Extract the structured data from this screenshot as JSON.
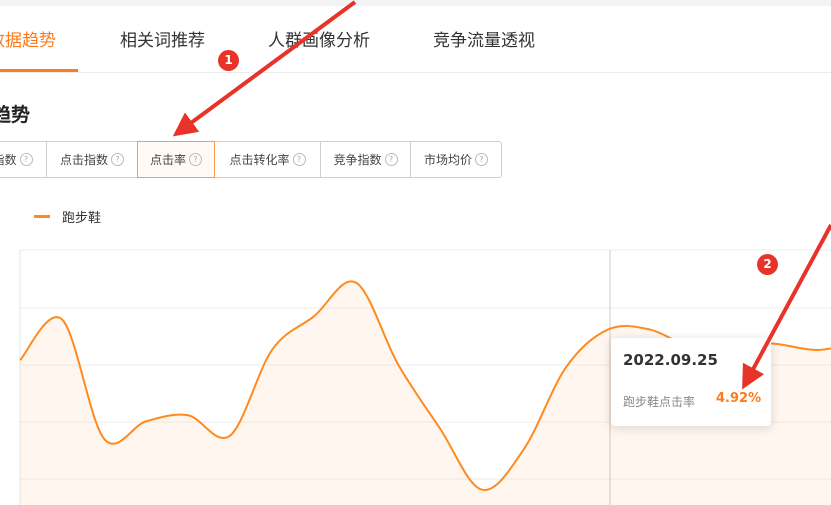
{
  "tabs": [
    {
      "label": "数据趋势",
      "active": true
    },
    {
      "label": "相关词推荐",
      "active": false
    },
    {
      "label": "人群画像分析",
      "active": false
    },
    {
      "label": "竞争流量透视",
      "active": false
    }
  ],
  "section_title": "趋势",
  "metric_buttons": [
    {
      "label": "指数",
      "active": false
    },
    {
      "label": "点击指数",
      "active": false
    },
    {
      "label": "点击率",
      "active": true
    },
    {
      "label": "点击转化率",
      "active": false
    },
    {
      "label": "竞争指数",
      "active": false
    },
    {
      "label": "市场均价",
      "active": false
    }
  ],
  "legend": {
    "series_name": "跑步鞋"
  },
  "tooltip": {
    "date": "2022.09.25",
    "label": "跑步鞋点击率",
    "value": "4.92%"
  },
  "annotations": {
    "badge_1": "1",
    "badge_2": "2"
  },
  "colors": {
    "accent": "#ff7a1a",
    "series": "#ff8a1f",
    "annotation": "#e8332a"
  },
  "chart_data": {
    "type": "area",
    "series": [
      {
        "name": "跑步鞋",
        "values": [
          4.62,
          5.02,
          3.85,
          4.02,
          4.08,
          3.88,
          4.72,
          5.05,
          5.38,
          4.58,
          3.95,
          3.35,
          3.75,
          4.55,
          4.92,
          4.92,
          4.75,
          4.8,
          4.78,
          4.72,
          4.8
        ]
      }
    ],
    "ylim": [
      3.2,
      5.7
    ],
    "grid": true
  }
}
